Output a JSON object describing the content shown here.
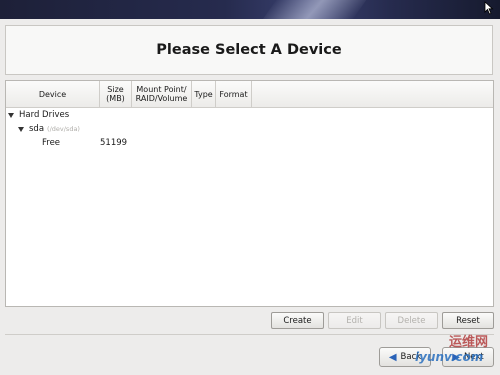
{
  "header": {
    "title": "Please Select A Device"
  },
  "table": {
    "columns": [
      "Device",
      "Size\n(MB)",
      "Mount Point/\nRAID/Volume",
      "Type",
      "Format"
    ],
    "tree": {
      "group_label": "Hard Drives",
      "disk_label": "sda",
      "disk_path": "(/dev/sda)",
      "free_label": "Free",
      "free_size": "51199"
    }
  },
  "actions": {
    "create": "Create",
    "edit": "Edit",
    "delete": "Delete",
    "reset": "Reset"
  },
  "nav": {
    "back": "Back",
    "next": "Next"
  },
  "watermark": {
    "text": "运维网",
    "sub": "iyunv.com"
  },
  "colors": {
    "banner": "#262b4e",
    "background": "#edeceb",
    "accent": "#2a62b8"
  }
}
